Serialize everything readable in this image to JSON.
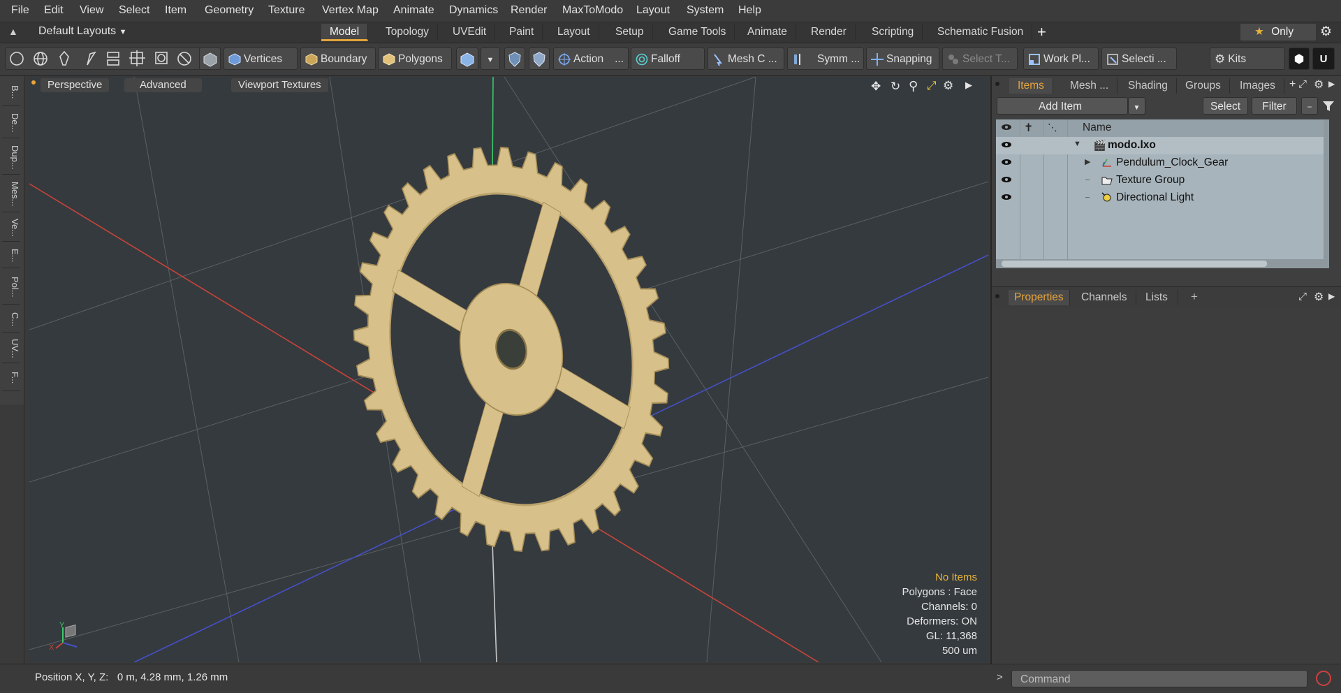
{
  "menubar": {
    "items": [
      "File",
      "Edit",
      "View",
      "Select",
      "Item",
      "Geometry",
      "Texture",
      "Vertex Map",
      "Animate",
      "Dynamics",
      "Render",
      "MaxToModo",
      "Layout",
      "System",
      "Help"
    ]
  },
  "layoutbar": {
    "layouts_label": "Default Layouts",
    "tabs": [
      "Model",
      "Topology",
      "UVEdit",
      "Paint",
      "Layout",
      "Setup",
      "Game Tools",
      "Animate",
      "Render",
      "Scripting",
      "Schematic Fusion"
    ],
    "active_tab": "Model",
    "only_label": "Only"
  },
  "toolbar": {
    "vertices": "Vertices",
    "boundary": "Boundary",
    "polygons": "Polygons",
    "action": "Action",
    "falloff": "Falloff",
    "mesh_c": "Mesh C ...",
    "symm": "Symm ...",
    "snapping": "Snapping",
    "select_t": "Select T...",
    "work_pl": "Work Pl...",
    "selecti": "Selecti ...",
    "kits": "Kits"
  },
  "left_tabs": [
    "B...",
    "De...",
    "Dup...",
    "Mes...",
    "Ve...",
    "E...",
    "Pol...",
    "C...",
    "UV...",
    "F..."
  ],
  "viewport": {
    "perspective": "Perspective",
    "advanced": "Advanced",
    "textures": "Viewport Textures",
    "info": {
      "no_items": "No Items",
      "polygons": "Polygons : Face",
      "channels": "Channels: 0",
      "deformers": "Deformers: ON",
      "gl": "GL: 11,368",
      "scale": "500 um"
    }
  },
  "statusbar": {
    "position": "Position X, Y, Z:   0 m, 4.28 mm, 1.26 mm"
  },
  "right_panel": {
    "tabs": [
      "Items",
      "Mesh ...",
      "Shading",
      "Groups",
      "Images"
    ],
    "active_tab": "Items",
    "add_item": "Add Item",
    "select": "Select",
    "filter": "Filter",
    "name_header": "Name",
    "items": [
      {
        "name": "modo.lxo",
        "bold": true
      },
      {
        "name": "Pendulum_Clock_Gear",
        "bold": false
      },
      {
        "name": "Texture Group",
        "bold": false
      },
      {
        "name": "Directional Light",
        "bold": false
      }
    ],
    "prop_tabs": [
      "Properties",
      "Channels",
      "Lists"
    ],
    "active_prop_tab": "Properties",
    "command_placeholder": "Command"
  },
  "colors": {
    "accent": "#e8a43a",
    "gear": "#d7c08a",
    "x_axis": "#c8443a",
    "z_axis": "#4450c8",
    "y_axis": "#3cc86a"
  }
}
